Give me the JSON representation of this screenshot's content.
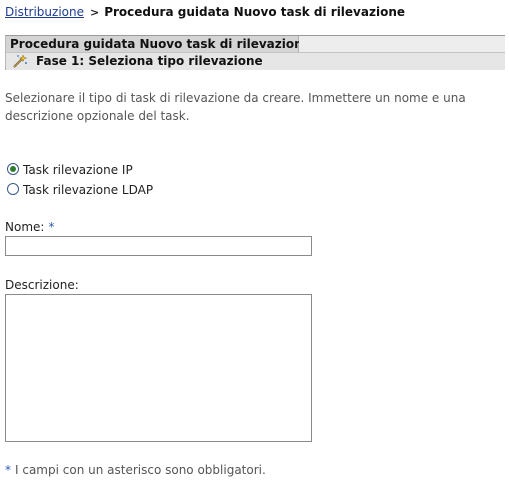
{
  "breadcrumb": {
    "parent_link": "Distribuzione",
    "separator": ">",
    "current": "Procedura guidata Nuovo task di rilevazione"
  },
  "wizard": {
    "title": "Procedura guidata Nuovo task di rilevazione",
    "step_icon": "wand-icon",
    "step_label": "Fase 1: Seleziona tipo rilevazione"
  },
  "intro_text": "Selezionare il tipo di task di rilevazione da creare. Immettere un nome e una descrizione opzionale del task.",
  "discovery_type": {
    "options": [
      {
        "label": "Task rilevazione IP",
        "selected": true
      },
      {
        "label": "Task rilevazione LDAP",
        "selected": false
      }
    ]
  },
  "form": {
    "name_label": "Nome:",
    "required_marker": "*",
    "name_value": "",
    "description_label": "Descrizione:",
    "description_value": ""
  },
  "footnote": {
    "marker": "*",
    "text": "I campi con un asterisco sono obbligatori."
  },
  "colors": {
    "link": "#1f3d8f",
    "required_star": "#2b5cb0",
    "title_bar": "#d4d4d4",
    "step_bar": "#e6e6e6",
    "radio_selected": "#2e7d32"
  }
}
